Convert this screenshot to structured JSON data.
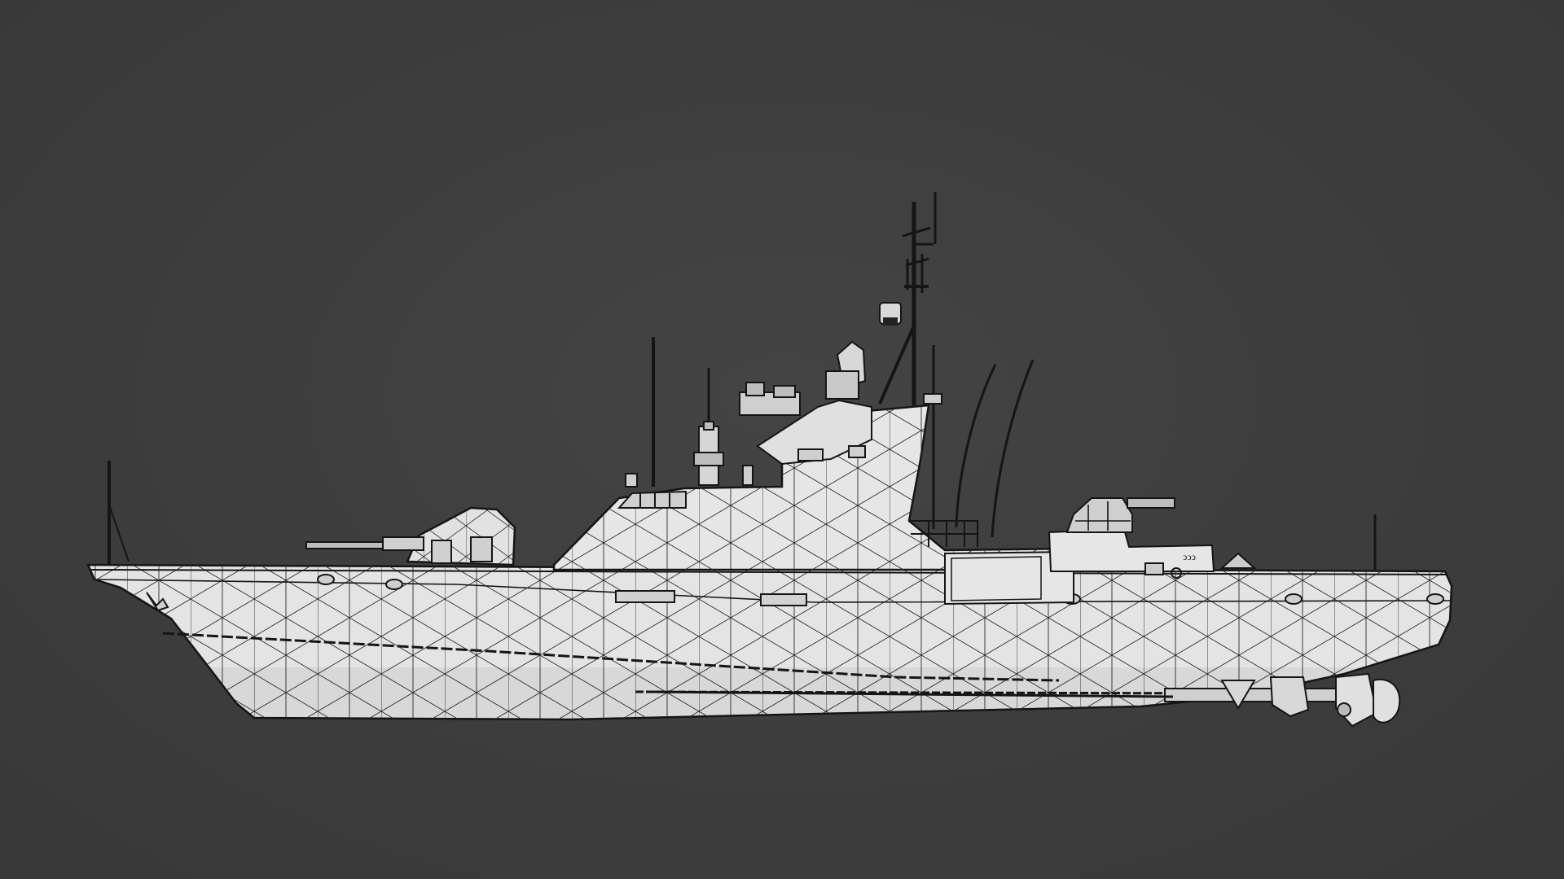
{
  "viewport": {
    "background_color": "#3d3d3d"
  },
  "model": {
    "subject": "ship-icon",
    "hull_color": "#e6e6e6",
    "shade_color": "#c9c9c9",
    "wire_color": "#1c1c1c",
    "view": "side"
  }
}
